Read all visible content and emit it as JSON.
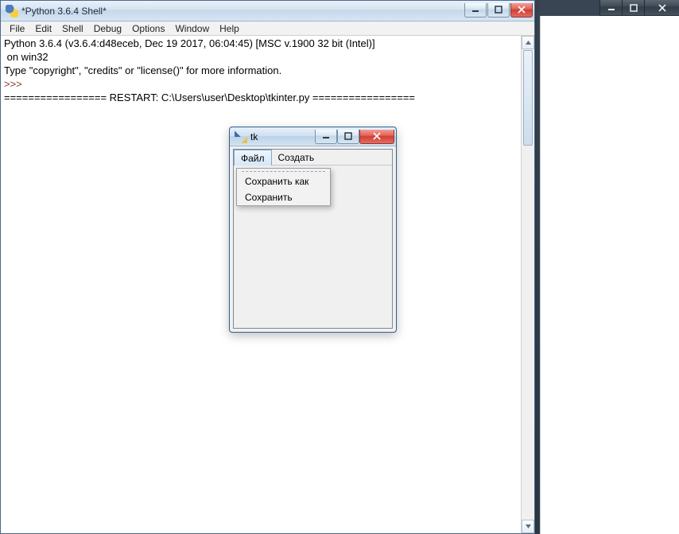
{
  "shell": {
    "title": "*Python 3.6.4 Shell*",
    "menus": [
      "File",
      "Edit",
      "Shell",
      "Debug",
      "Options",
      "Window",
      "Help"
    ],
    "line1": "Python 3.6.4 (v3.6.4:d48eceb, Dec 19 2017, 06:04:45) [MSC v.1900 32 bit (Intel)]",
    "line2": " on win32",
    "line3": "Type \"copyright\", \"credits\" or \"license()\" for more information.",
    "prompt": ">>> ",
    "restart": "================= RESTART: C:\\Users\\user\\Desktop\\tkinter.py ================="
  },
  "tk": {
    "title": "tk",
    "menus": {
      "file": "Файл",
      "create": "Создать"
    },
    "dropdown": {
      "save_as": "Сохранить как",
      "save": "Сохранить"
    }
  }
}
